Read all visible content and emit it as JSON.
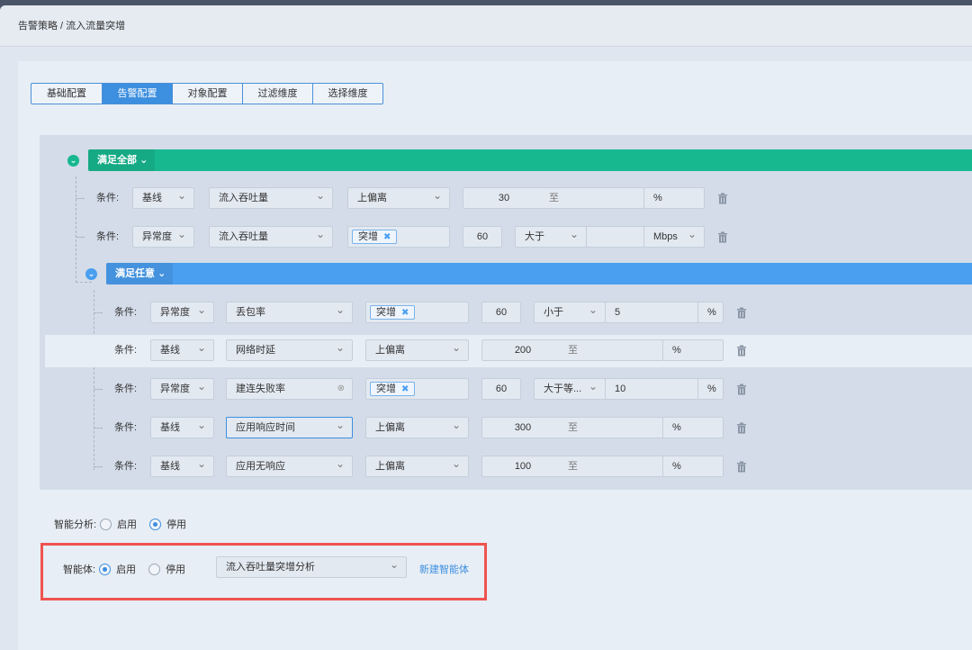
{
  "breadcrumb": "告警策略 / 流入流量突增",
  "tabs": [
    "基础配置",
    "告警配置",
    "对象配置",
    "过滤维度",
    "选择维度"
  ],
  "active_tab": 1,
  "group_all": {
    "label": "满足全部"
  },
  "group_any": {
    "label": "满足任意"
  },
  "cond_label": "条件:",
  "rows": [
    {
      "type": "基线",
      "metric": "流入吞吐量",
      "mode": "上偏离",
      "low": "30",
      "to": "至",
      "unit": "%"
    },
    {
      "type": "异常度",
      "metric": "流入吞吐量",
      "tag": "突增",
      "value": "60",
      "cmp": "大于",
      "unit": "Mbps"
    },
    {
      "type": "异常度",
      "metric": "丢包率",
      "tag": "突增",
      "value": "60",
      "cmp": "小于",
      "threshold": "5",
      "unit": "%"
    },
    {
      "type": "基线",
      "metric": "网络时延",
      "mode": "上偏离",
      "low": "200",
      "to": "至",
      "unit": "%"
    },
    {
      "type": "异常度",
      "metric": "建连失败率",
      "tag": "突增",
      "value": "60",
      "cmp": "大于等...",
      "threshold": "10",
      "unit": "%"
    },
    {
      "type": "基线",
      "metric": "应用响应时间",
      "mode": "上偏离",
      "low": "300",
      "to": "至",
      "unit": "%"
    },
    {
      "type": "基线",
      "metric": "应用无响应",
      "mode": "上偏离",
      "low": "100",
      "to": "至",
      "unit": "%"
    }
  ],
  "smart_analysis": {
    "label": "智能分析:",
    "enable": "启用",
    "disable": "停用",
    "selected": "disable"
  },
  "agent": {
    "label": "智能体:",
    "enable": "启用",
    "disable": "停用",
    "selected": "enable",
    "select_value": "流入吞吐量突增分析",
    "new_link": "新建智能体"
  },
  "colors": {
    "green": "#17b890",
    "blue": "#4a9ff0",
    "accent": "#3d8fe0",
    "highlight": "#ef5350"
  }
}
